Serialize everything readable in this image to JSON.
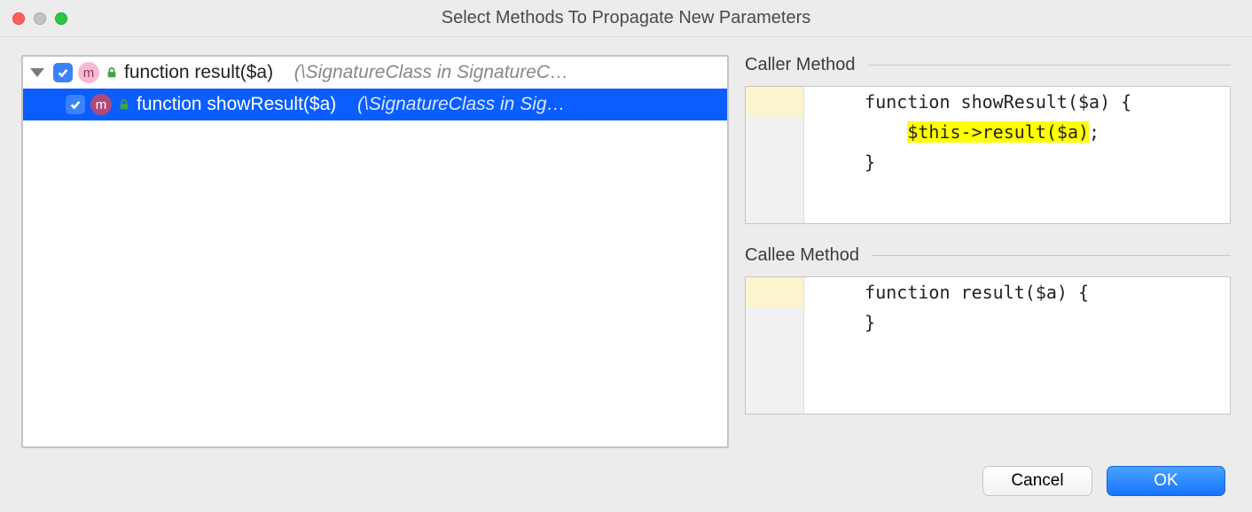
{
  "window": {
    "title": "Select Methods To Propagate New Parameters"
  },
  "tree": {
    "items": [
      {
        "checked": true,
        "badge": "m",
        "label": "function result($a)",
        "hint": "(\\SignatureClass in SignatureC…",
        "selected": false,
        "level": 0
      },
      {
        "checked": true,
        "badge": "m",
        "label": "function showResult($a)",
        "hint": "(\\SignatureClass in Sig…",
        "selected": true,
        "level": 1
      }
    ]
  },
  "caller": {
    "title": "Caller Method",
    "lines": [
      {
        "modified": true,
        "indent": "    ",
        "pre": "function showResult($a) {",
        "hl": "",
        "post": ""
      },
      {
        "modified": false,
        "indent": "        ",
        "pre": "",
        "hl": "$this->result($a)",
        "post": ";"
      },
      {
        "modified": false,
        "indent": "    ",
        "pre": "}",
        "hl": "",
        "post": ""
      }
    ]
  },
  "callee": {
    "title": "Callee Method",
    "lines": [
      {
        "modified": true,
        "indent": "    ",
        "pre": "function result($a) {",
        "hl": "",
        "post": ""
      },
      {
        "modified": false,
        "indent": "    ",
        "pre": "}",
        "hl": "",
        "post": ""
      }
    ]
  },
  "buttons": {
    "cancel": "Cancel",
    "ok": "OK"
  }
}
